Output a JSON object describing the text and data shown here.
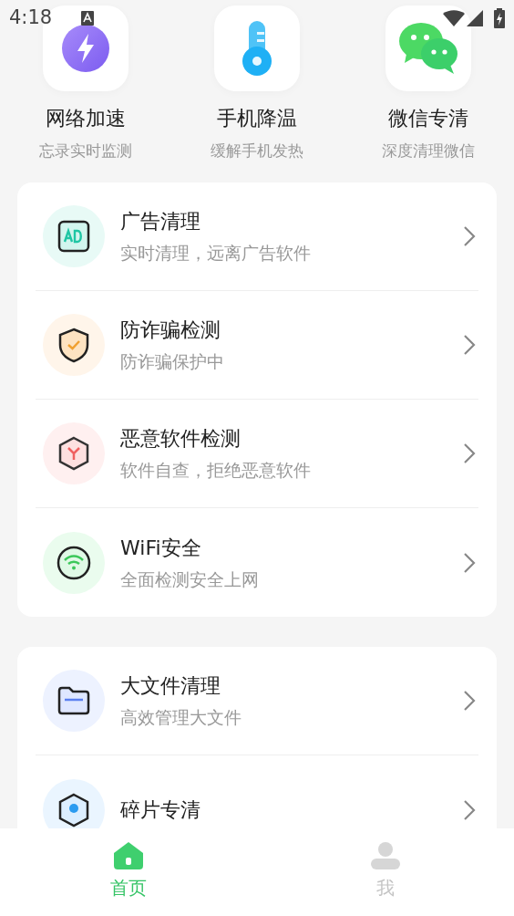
{
  "status_bar": {
    "time": "4:18"
  },
  "shortcuts": [
    {
      "title": "网络加速",
      "subtitle": "忘录实时监测"
    },
    {
      "title": "手机降温",
      "subtitle": "缓解手机发热"
    },
    {
      "title": "微信专清",
      "subtitle": "深度清理微信"
    }
  ],
  "cards": [
    {
      "items": [
        {
          "title": "广告清理",
          "subtitle": "实时清理，远离广告软件"
        },
        {
          "title": "防诈骗检测",
          "subtitle": "防诈骗保护中"
        },
        {
          "title": "恶意软件检测",
          "subtitle": "软件自查，拒绝恶意软件"
        },
        {
          "title": "WiFi安全",
          "subtitle": "全面检测安全上网"
        }
      ]
    },
    {
      "items": [
        {
          "title": "大文件清理",
          "subtitle": "高效管理大文件"
        },
        {
          "title": "碎片专清"
        }
      ]
    }
  ],
  "tab_bar": [
    {
      "label": "首页",
      "selected": true
    },
    {
      "label": "我",
      "selected": false
    }
  ]
}
